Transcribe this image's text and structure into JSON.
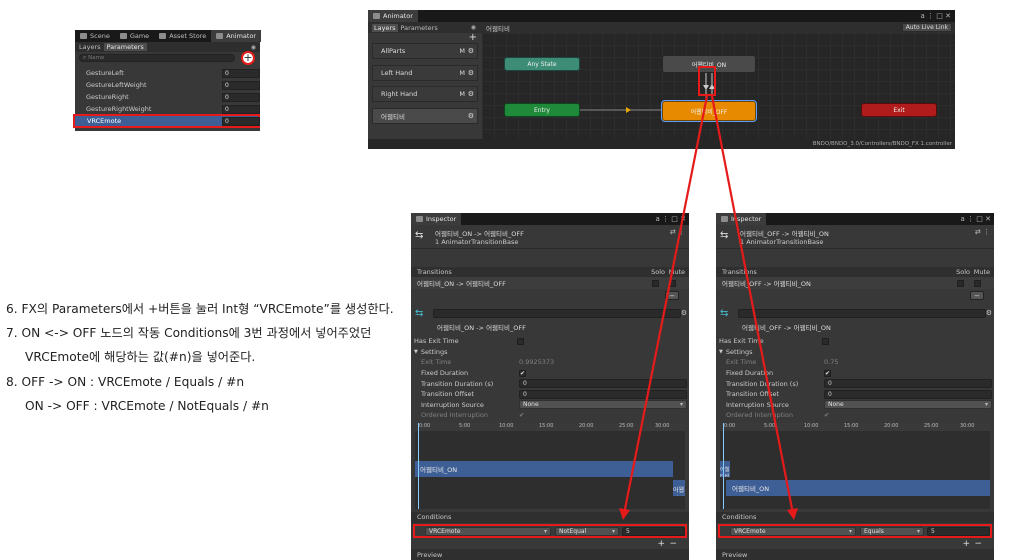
{
  "colors": {
    "highlight": "#e51b1b",
    "anystate": "#3c8c76",
    "entry": "#1f8a3a",
    "exit": "#b01b1b",
    "selected_node": "#e88a00",
    "selected_row": "#3e5f96",
    "track_blue": "#3e5f96"
  },
  "params": {
    "tabs": [
      "Scene",
      "Game",
      "Asset Store",
      "Animator"
    ],
    "sub_tabs": [
      "Layers",
      "Parameters"
    ],
    "search_placeholder": "Name",
    "add_icon": "plus-icon",
    "items": [
      {
        "name": "GestureLeft",
        "value": "0"
      },
      {
        "name": "GestureLeftWeight",
        "value": "0"
      },
      {
        "name": "GestureRight",
        "value": "0"
      },
      {
        "name": "GestureRightWeight",
        "value": "0"
      },
      {
        "name": "VRCEmote",
        "value": "0"
      }
    ]
  },
  "animator": {
    "tab": "Animator",
    "sub_tabs": [
      "Layers",
      "Parameters"
    ],
    "breadcrumb": "어웹티비",
    "auto_live_link": "Auto Live Link",
    "layers": [
      {
        "name": "AllParts",
        "flag": "M"
      },
      {
        "name": "Left Hand",
        "flag": "M"
      },
      {
        "name": "Right Hand",
        "flag": "M"
      },
      {
        "name": "어웹티비",
        "flag": ""
      }
    ],
    "nodes": {
      "any_state": "Any State",
      "on": "어웹티비_ON",
      "entry": "Entry",
      "off": "어웹티비_OFF",
      "exit": "Exit"
    },
    "footer_path": "BNDO/BNDO_3.0/Controllers/BNDO_FX 1.controller"
  },
  "instructions": [
    "6. FX의 Parameters에서 +버튼을 눌러 Int형 “VRCEmote”를 생성한다.",
    "7. ON <-> OFF 노드의 작동 Conditions에 3번 과정에서 넣어주었던",
    "VRCEmote에 해당하는 값(#n)을 넣어준다.",
    "8.  OFF -> ON : VRCEmote / Equals / #n",
    "ON -> OFF : VRCEmote / NotEquals / #n"
  ],
  "inspector_left": {
    "tab": "Inspector",
    "title": "어웹티비_ON -> 어웹티비_OFF",
    "subtitle": "1 AnimatorTransitionBase",
    "transitions_label": "Transitions",
    "solo": "Solo",
    "mute": "Mute",
    "transition_item": "어웹티비_ON -> 어웹티비_OFF",
    "name_label": "어웹티비_ON -> 어웹티비_OFF",
    "has_exit_time": "Has Exit Time",
    "settings": "Settings",
    "settings_rows": [
      {
        "label": "Exit Time",
        "value": "0.9925373",
        "dim": true
      },
      {
        "label": "Fixed Duration",
        "value": "✔"
      },
      {
        "label": "Transition Duration (s)",
        "value": "0"
      },
      {
        "label": "Transition Offset",
        "value": "0"
      },
      {
        "label": "Interruption Source",
        "value": "None"
      },
      {
        "label": "Ordered Interruption",
        "value": "✔",
        "dim": true
      }
    ],
    "ticks": [
      "0:00",
      "5:00",
      "10:00",
      "15:00",
      "20:00",
      "25:00",
      "30:00"
    ],
    "track_top": "어웹티비_ON",
    "track_bottom": "어웹티비_OFF",
    "conditions_label": "Conditions",
    "cond_param": "VRCEmote",
    "cond_mode": "NotEqual",
    "cond_value": "5",
    "preview": "Preview"
  },
  "inspector_right": {
    "tab": "Inspector",
    "title": "어웹티비_OFF -> 어웹티비_ON",
    "subtitle": "1 AnimatorTransitionBase",
    "transitions_label": "Transitions",
    "solo": "Solo",
    "mute": "Mute",
    "transition_item": "어웹티비_OFF -> 어웹티비_ON",
    "name_label": "어웹티비_OFF -> 어웹티비_ON",
    "has_exit_time": "Has Exit Time",
    "settings": "Settings",
    "settings_rows": [
      {
        "label": "Exit Time",
        "value": "0.75",
        "dim": true
      },
      {
        "label": "Fixed Duration",
        "value": "✔"
      },
      {
        "label": "Transition Duration (s)",
        "value": "0"
      },
      {
        "label": "Transition Offset",
        "value": "0"
      },
      {
        "label": "Interruption Source",
        "value": "None"
      },
      {
        "label": "Ordered Interruption",
        "value": "✔",
        "dim": true
      }
    ],
    "ticks": [
      "0:00",
      "5:00",
      "10:00",
      "15:00",
      "20:00",
      "25:00",
      "30:00"
    ],
    "track_top": "어웹티비_OFF",
    "track_bottom": "어웹티비_ON",
    "conditions_label": "Conditions",
    "cond_param": "VRCEmote",
    "cond_mode": "Equals",
    "cond_value": "5",
    "preview": "Preview"
  }
}
